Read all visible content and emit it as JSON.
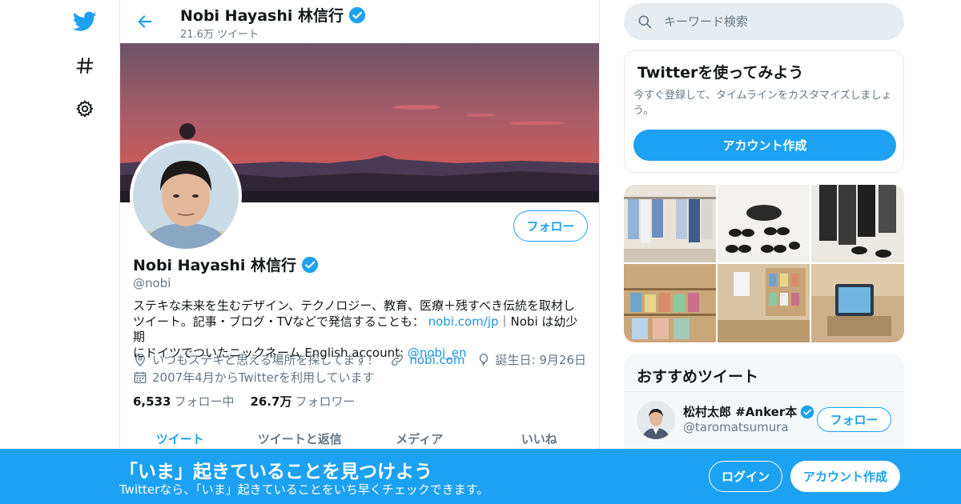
{
  "colors": {
    "accent": "#1da1f2",
    "text": "#14171a",
    "secondary": "#657786",
    "link": "#1b95e0"
  },
  "nav": {
    "icons": [
      "twitter-bird-icon",
      "hashtag-icon",
      "gear-icon"
    ]
  },
  "header": {
    "name": "Nobi Hayashi 林信行",
    "tweet_count": "21.6万 ツイート"
  },
  "profile": {
    "follow_label": "フォロー",
    "name": "Nobi Hayashi 林信行",
    "handle": "@nobi",
    "bio_line1": "ステキな未来を生むデザイン、テクノロジー、教育、医療＋残すべき伝統を取材し",
    "bio_line2_text": "ツイート。記事・ブログ・TVなどで発信することも：",
    "bio_link1": "nobi.com/jp",
    "bio_line2_tail": "｜Nobi は幼少期",
    "bio_line3_text": "にドイツでついたニックネーム English account:",
    "bio_link2": "@nobi_en",
    "location": "いつもステキと思える場所を探してます！",
    "website": "nobi.com",
    "birthday": "誕生日: 9月26日",
    "joined": "2007年4月からTwitterを利用しています",
    "following_count": "6,533",
    "following_label": "フォロー中",
    "followers_count": "26.7万",
    "followers_label": "フォロワー"
  },
  "tabs": [
    "ツイート",
    "ツイートと返信",
    "メディア",
    "いいね"
  ],
  "search": {
    "placeholder": "キーワード検索"
  },
  "signup_card": {
    "title": "Twitterを使ってみよう",
    "text": "今すぐ登録して、タイムラインをカスタマイズしましょう。",
    "button": "アカウント作成"
  },
  "recommended": {
    "title": "おすすめツイート",
    "name": "松村太郎 #Anker本",
    "handle": "@taromatsumura",
    "follow_label": "フォロー"
  },
  "bottom_bar": {
    "title": "「いま」起きていることを見つけよう",
    "subtitle": "Twitterなら、「いま」起きていることをいち早くチェックできます。",
    "login": "ログイン",
    "signup": "アカウント作成"
  }
}
